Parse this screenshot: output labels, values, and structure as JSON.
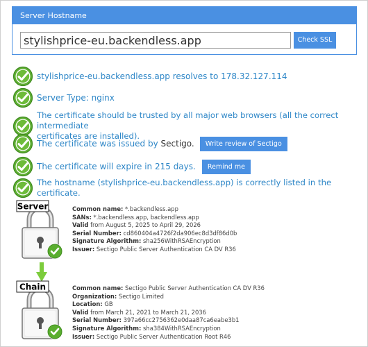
{
  "panel": {
    "header": "Server Hostname",
    "hostname_value": "stylishprice-eu.backendless.app",
    "check_button": "Check SSL"
  },
  "checks": {
    "resolve": "stylishprice-eu.backendless.app resolves to 178.32.127.114",
    "server_type": "Server Type: nginx",
    "trusted_line1": "The certificate should be trusted by all major web browsers (all the correct intermediate",
    "trusted_line2": "certificates are installed).",
    "issued_by_prefix": "The certificate was issued by ",
    "issued_by_value": "Sectigo.",
    "review_button": "Write review of Sectigo",
    "expire_text": "The certificate will expire in 215 days.",
    "remind_button": "Remind me",
    "hostname_listed": "The hostname (stylishprice-eu.backendless.app) is correctly listed in the certificate."
  },
  "server_cert": {
    "badge": "Server",
    "common_name_label": "Common name:",
    "common_name": "*.backendless.app",
    "sans_label": "SANs:",
    "sans": "*.backendless.app, backendless.app",
    "valid_label": "Valid",
    "valid": "from August 5, 2025 to April 29, 2026",
    "serial_label": "Serial Number:",
    "serial": "cd860404a4726f2da906ec8d3df86d0b",
    "sig_label": "Signature Algorithm:",
    "sig": "sha256WithRSAEncryption",
    "issuer_label": "Issuer:",
    "issuer": "Sectigo Public Server Authentication CA DV R36"
  },
  "chain_cert": {
    "badge": "Chain",
    "common_name_label": "Common name:",
    "common_name": "Sectigo Public Server Authentication CA DV R36",
    "org_label": "Organization:",
    "org": "Sectigo Limited",
    "location_label": "Location:",
    "location": "GB",
    "valid_label": "Valid",
    "valid": "from March 21, 2021 to March 21, 2036",
    "serial_label": "Serial Number:",
    "serial": "397a66cc2756362e0daa87ca6eabe3b1",
    "sig_label": "Signature Algorithm:",
    "sig": "sha384WithRSAEncryption",
    "issuer_label": "Issuer:",
    "issuer": "Sectigo Public Server Authentication Root R46"
  },
  "colors": {
    "accent": "#4a90e2",
    "message_blue": "#2d86c7",
    "check_green": "#57a82c",
    "arrow_green": "#7ccc3c"
  },
  "icons": {
    "check": "green-checkmark-circle-icon",
    "cert": "padlock-certificate-icon",
    "arrow": "down-arrow-icon"
  }
}
